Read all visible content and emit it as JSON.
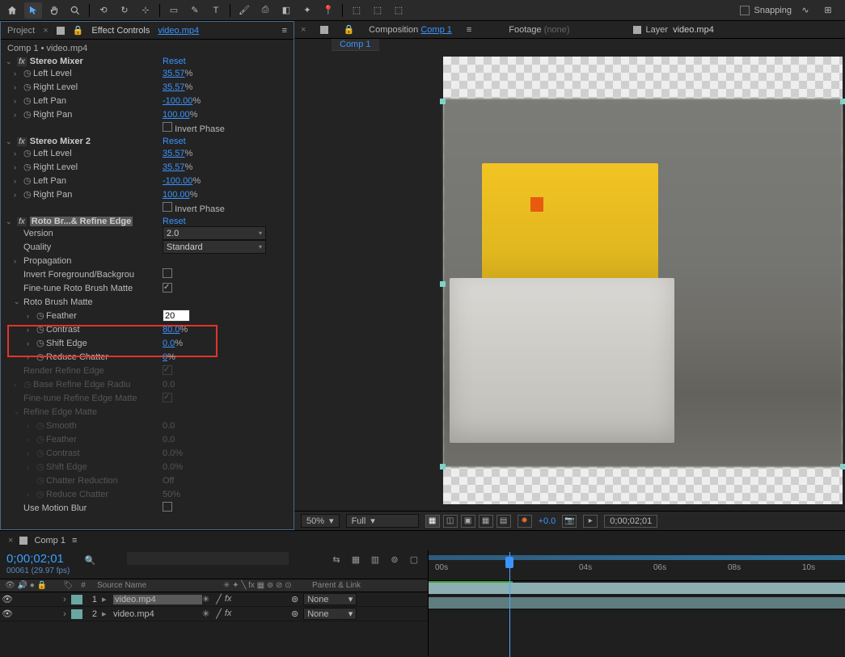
{
  "toolbar": {
    "snapping_label": "Snapping"
  },
  "panels": {
    "project_tab": "Project",
    "effect_controls_tab": "Effect Controls",
    "effect_controls_source": "video.mp4",
    "breadcrumb": "Comp 1 • video.mp4"
  },
  "effects": {
    "stereo1": {
      "name": "Stereo Mixer",
      "reset": "Reset",
      "left_level": {
        "label": "Left Level",
        "value": "35.57",
        "unit": "%"
      },
      "right_level": {
        "label": "Right Level",
        "value": "35.57",
        "unit": "%"
      },
      "left_pan": {
        "label": "Left Pan",
        "value": "-100.00",
        "unit": "%"
      },
      "right_pan": {
        "label": "Right Pan",
        "value": "100.00",
        "unit": "%"
      },
      "invert_phase": "Invert Phase"
    },
    "stereo2": {
      "name": "Stereo Mixer 2",
      "reset": "Reset",
      "left_level": {
        "label": "Left Level",
        "value": "35.57",
        "unit": "%"
      },
      "right_level": {
        "label": "Right Level",
        "value": "35.57",
        "unit": "%"
      },
      "left_pan": {
        "label": "Left Pan",
        "value": "-100.00",
        "unit": "%"
      },
      "right_pan": {
        "label": "Right Pan",
        "value": "100.00",
        "unit": "%"
      },
      "invert_phase": "Invert Phase"
    },
    "roto": {
      "name": "Roto Br...& Refine Edge",
      "reset": "Reset",
      "version_label": "Version",
      "version_value": "2.0",
      "quality_label": "Quality",
      "quality_value": "Standard",
      "propagation": "Propagation",
      "invert_fg": "Invert Foreground/Backgrou",
      "fine_tune_rbm": "Fine-tune Roto Brush Matte",
      "matte_header": "Roto Brush Matte",
      "feather": {
        "label": "Feather",
        "value": "20"
      },
      "contrast": {
        "label": "Contrast",
        "value": "80.0",
        "unit": "%"
      },
      "shift_edge": {
        "label": "Shift Edge",
        "value": "0.0",
        "unit": "%"
      },
      "reduce_chatter": {
        "label": "Reduce Chatter",
        "value": "0",
        "unit": "%"
      },
      "render_refine": "Render Refine Edge",
      "base_refine": {
        "label": "Base Refine Edge Radiu",
        "value": "0.0"
      },
      "fine_tune_rem": "Fine-tune Refine Edge Matte",
      "refine_header": "Refine Edge Matte",
      "smooth": {
        "label": "Smooth",
        "value": "0.0"
      },
      "rfeather": {
        "label": "Feather",
        "value": "0.0"
      },
      "rcontrast": {
        "label": "Contrast",
        "value": "0.0",
        "unit": "%"
      },
      "rshift": {
        "label": "Shift Edge",
        "value": "0.0",
        "unit": "%"
      },
      "chatter_red": {
        "label": "Chatter Reduction",
        "value": "Off"
      },
      "rreduce": {
        "label": "Reduce Chatter",
        "value": "50",
        "unit": "%"
      },
      "motion_blur": "Use Motion Blur"
    }
  },
  "comp_panel": {
    "composition_label": "Composition",
    "composition_name": "Comp 1",
    "footage_label": "Footage",
    "footage_value": "(none)",
    "layer_label": "Layer",
    "layer_value": "video.mp4",
    "subtab": "Comp 1"
  },
  "preview_footer": {
    "zoom": "50%",
    "resolution": "Full",
    "exposure": "+0.0",
    "timecode": "0;00;02;01"
  },
  "timeline": {
    "tab": "Comp 1",
    "timecode": "0;00;02;01",
    "frame_info": "00061 (29.97 fps)",
    "col_num": "#",
    "col_source": "Source Name",
    "col_parent": "Parent & Link",
    "layers": [
      {
        "num": "1",
        "name": "video.mp4",
        "none": "None"
      },
      {
        "num": "2",
        "name": "video.mp4",
        "none": "None"
      }
    ],
    "ruler": [
      "00s",
      "04s",
      "06s",
      "08s",
      "10s"
    ]
  }
}
